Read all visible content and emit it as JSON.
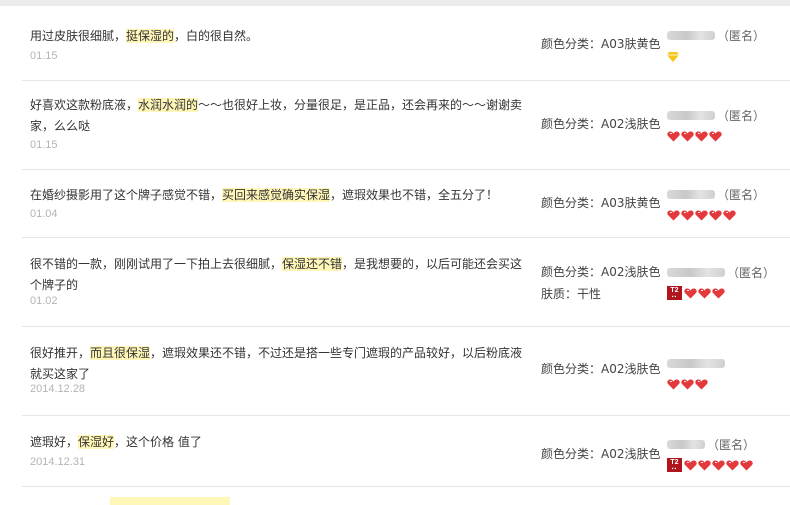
{
  "reviews": [
    {
      "pre": "用过皮肤很细腻，",
      "hl": "挺保湿的",
      "post": "，白的很自然。",
      "date": "01.15",
      "attrs": [
        "颜色分类：A03肤黄色"
      ],
      "anon": "（匿名）",
      "badge": {
        "t2": false,
        "icon": "diamond",
        "count": 1
      }
    },
    {
      "pre": "好喜欢这款粉底液，",
      "hl": "水润水润的",
      "post": "～～也很好上妆，分量很足，是正品，还会再来的～～谢谢卖家，么么哒",
      "date": "01.15",
      "attrs": [
        "颜色分类：A02浅肤色"
      ],
      "anon": "（匿名）",
      "badge": {
        "t2": false,
        "icon": "heart",
        "count": 4
      }
    },
    {
      "pre": "在婚纱摄影用了这个牌子感觉不错，",
      "hl": "买回来感觉确实保湿",
      "post": "，遮瑕效果也不错，全五分了！",
      "date": "01.04",
      "attrs": [
        "颜色分类：A03肤黄色"
      ],
      "anon": "（匿名）",
      "badge": {
        "t2": false,
        "icon": "heart",
        "count": 5
      }
    },
    {
      "pre": "很不错的一款，刚刚试用了一下拍上去很细腻，",
      "hl": "保湿还不错",
      "post": "，是我想要的，以后可能还会买这个牌子的",
      "date": "01.02",
      "attrs": [
        "颜色分类：A02浅肤色",
        "肤质：干性"
      ],
      "anon": "（匿名）",
      "badge": {
        "t2": true,
        "t2_label": "T2",
        "icon": "heart",
        "count": 3
      }
    },
    {
      "pre": "很好推开，",
      "hl": "而且很保湿",
      "post": "，遮瑕效果还不错，不过还是搭一些专门遮瑕的产品较好，以后粉底液就买这家了",
      "date": "2014.12.28",
      "attrs": [
        "颜色分类：A02浅肤色"
      ],
      "anon": "",
      "badge": {
        "t2": false,
        "icon": "heart",
        "count": 3
      }
    },
    {
      "pre": "遮瑕好，",
      "hl": "保湿好",
      "post": "，这个价格 值了",
      "date": "2014.12.31",
      "attrs": [
        "颜色分类：A02浅肤色"
      ],
      "anon": "（匿名）",
      "badge": {
        "t2": true,
        "t2_label": "T2",
        "icon": "heart",
        "count": 5
      }
    }
  ],
  "colors": {
    "highlight": "#fff6b8",
    "heart": "#e4393c",
    "diamond": "#f5c518",
    "t2_badge": "#b0141d"
  }
}
